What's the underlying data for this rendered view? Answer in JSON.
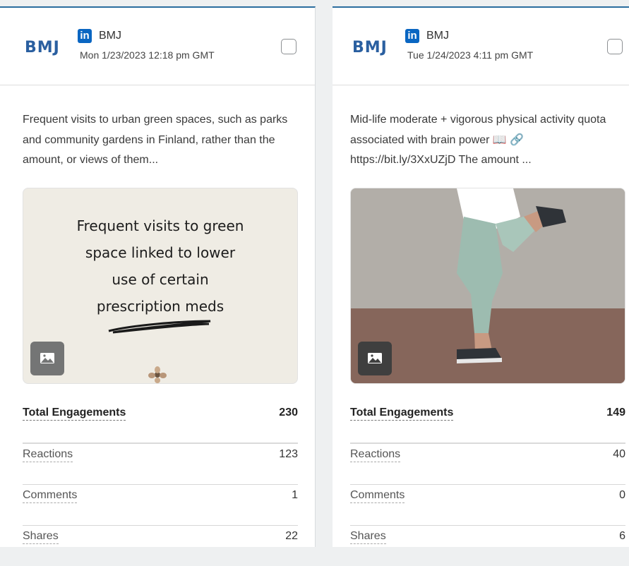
{
  "posts": [
    {
      "logo": "BMJ",
      "network_icon": "in",
      "account": "BMJ",
      "date": "Mon 1/23/2023 12:18 pm GMT",
      "text": "Frequent visits to urban green spaces, such as parks and community gardens in Finland, rather than the amount, or views of them...",
      "image_text": [
        "Frequent visits to green",
        "space linked to lower",
        "use of certain",
        "prescription meds"
      ],
      "stats": {
        "total_label": "Total Engagements",
        "total": "230",
        "reactions_label": "Reactions",
        "reactions": "123",
        "comments_label": "Comments",
        "comments": "1",
        "shares_label": "Shares",
        "shares": "22"
      }
    },
    {
      "logo": "BMJ",
      "network_icon": "in",
      "account": "BMJ",
      "date": "Tue 1/24/2023 4:11 pm GMT",
      "text": "Mid-life moderate + vigorous physical activity quota associated with brain power 📖 🔗 https://bit.ly/3XxUZjD The amount ...",
      "stats": {
        "total_label": "Total Engagements",
        "total": "149",
        "reactions_label": "Reactions",
        "reactions": "40",
        "comments_label": "Comments",
        "comments": "0",
        "shares_label": "Shares",
        "shares": "6"
      }
    }
  ],
  "colors": {
    "linkedin": "#0a66c2",
    "bmj_logo": "#2a5fa0",
    "top_border": "#2b6d9e"
  }
}
